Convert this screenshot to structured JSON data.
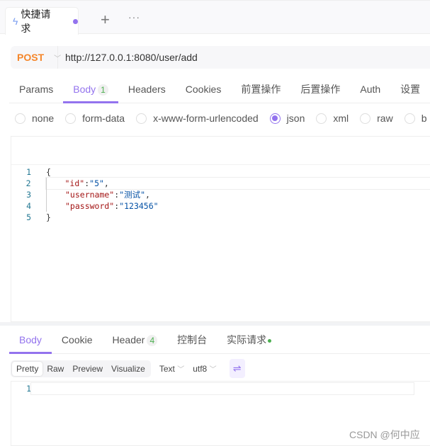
{
  "tabbar": {
    "active_tab": {
      "icon": "lightning-icon",
      "label": "快捷请求",
      "unsaved": true
    },
    "add_icon": "+",
    "more_icon": "···"
  },
  "request": {
    "method": "POST",
    "url": "http://127.0.0.1:8080/user/add"
  },
  "request_tabs": [
    {
      "label": "Params"
    },
    {
      "label": "Body",
      "badge": "1",
      "active": true
    },
    {
      "label": "Headers"
    },
    {
      "label": "Cookies"
    },
    {
      "label": "前置操作"
    },
    {
      "label": "后置操作"
    },
    {
      "label": "Auth"
    },
    {
      "label": "设置"
    }
  ],
  "body_types": [
    {
      "label": "none"
    },
    {
      "label": "form-data"
    },
    {
      "label": "x-www-form-urlencoded"
    },
    {
      "label": "json",
      "selected": true
    },
    {
      "label": "xml"
    },
    {
      "label": "raw"
    },
    {
      "label": "b"
    }
  ],
  "editor": {
    "lines": [
      {
        "n": "1",
        "text": "{"
      },
      {
        "n": "2",
        "key": "\"id\"",
        "val": "\"5\"",
        "tail": ","
      },
      {
        "n": "3",
        "key": "\"username\"",
        "val": "\"测试\"",
        "tail": ","
      },
      {
        "n": "4",
        "key": "\"password\"",
        "val": "\"123456\"",
        "tail": ""
      },
      {
        "n": "5",
        "text": "}"
      }
    ]
  },
  "response_tabs": [
    {
      "label": "Body",
      "active": true
    },
    {
      "label": "Cookie"
    },
    {
      "label": "Header",
      "badge": "4"
    },
    {
      "label": "控制台"
    },
    {
      "label": "实际请求",
      "dot": true
    }
  ],
  "response_toolbar": {
    "views": [
      "Pretty",
      "Raw",
      "Preview",
      "Visualize"
    ],
    "active_view": "Pretty",
    "format": "Text",
    "encoding": "utf8"
  },
  "response_editor": {
    "line": "1"
  },
  "watermark": "CSDN @何中应",
  "colors": {
    "accent": "#9373ee",
    "method": "#f5862a",
    "badge": "#4caf50"
  }
}
